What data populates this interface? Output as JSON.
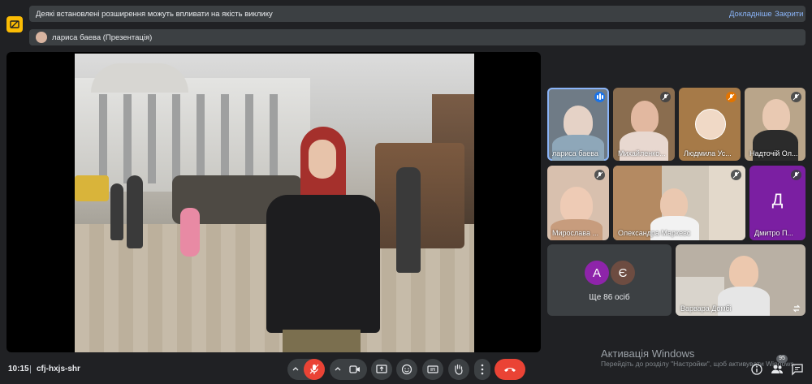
{
  "notice": {
    "text": "Деякі встановлені розширення можуть впливати на якість виклику",
    "details_label": "Докладніше",
    "close_label": "Закрити"
  },
  "presenter": {
    "label": "лариса баева (Презентація)"
  },
  "participants": [
    {
      "name": "лариса баева",
      "speaking": true
    },
    {
      "name": "Михайленко...",
      "muted": true
    },
    {
      "name": "Людмила Ус...",
      "muted": true
    },
    {
      "name": "Надточій Ол...",
      "muted": true
    },
    {
      "name": "Мирослава ...",
      "muted": true
    },
    {
      "name": "Олександра Маркевс",
      "muted": true
    },
    {
      "name": "Дмитро П...",
      "initial": "Д",
      "muted": true
    },
    {
      "name": "Варвара Домбі",
      "muted": false
    }
  ],
  "more": {
    "initials": [
      "А",
      "Є"
    ],
    "label": "Ще 86 осіб"
  },
  "watermark": {
    "title": "Активація Windows",
    "subtitle": "Перейдіть до розділу \"Настройки\", щоб активувати Windows."
  },
  "bottom": {
    "time": "10:15",
    "meeting_code": "cfj-hxjs-shr",
    "participants_badge": "95"
  },
  "colors": {
    "end_call": "#ea4335",
    "mic_off": "#ea4335",
    "link": "#8ab4f8",
    "extension": "#fbbc04",
    "avatar_a": "#8e24aa",
    "avatar_e": "#6d4c41"
  }
}
